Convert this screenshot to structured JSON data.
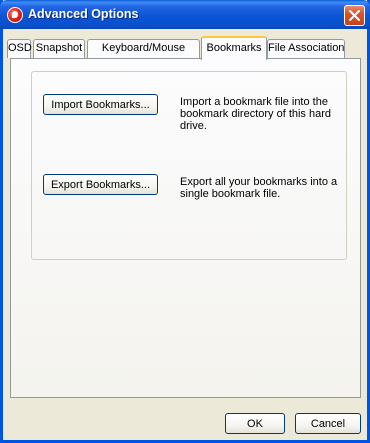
{
  "window": {
    "title": "Advanced Options",
    "app_icon": "media-player-icon",
    "close_icon": "close-icon"
  },
  "tabs": [
    {
      "label": "OSD",
      "active": false
    },
    {
      "label": "Snapshot",
      "active": false
    },
    {
      "label": "Keyboard/Mouse",
      "active": false
    },
    {
      "label": "Bookmarks",
      "active": true
    },
    {
      "label": "File Association",
      "active": false
    }
  ],
  "bookmarks": {
    "import_label": "Import Bookmarks...",
    "import_description": "Import a bookmark file into the bookmark directory of this hard drive.",
    "export_label": "Export Bookmarks...",
    "export_description": "Export all your bookmarks into a single bookmark file."
  },
  "footer": {
    "ok_label": "OK",
    "cancel_label": "Cancel"
  },
  "colors": {
    "titlebar": "#0a55d6",
    "close_button": "#d9542a",
    "active_tab_accent": "#ffc83c",
    "button_border": "#003c74"
  }
}
